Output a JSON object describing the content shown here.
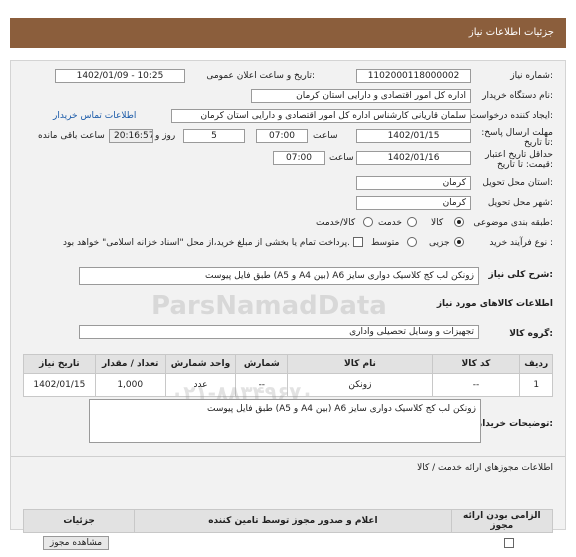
{
  "header": {
    "title": "جزئیات اطلاعات نیاز"
  },
  "fields": {
    "need_number_label": "شماره نیاز:",
    "need_number": "1102000118000002",
    "announce_label": "تاریخ و ساعت اعلان عمومی:",
    "announce_value": "1402/01/09 - 10:25",
    "buyer_org_label": "نام دستگاه خریدار:",
    "buyer_org": "اداره کل امور اقتصادی و دارایی استان کرمان",
    "creator_label": "ایجاد کننده درخواست:",
    "creator": "سلمان قاریانی کارشناس اداره کل امور اقتصادی و دارایی استان کرمان",
    "contact_link": "اطلاعات تماس خریدار",
    "deadline_label": "مهلت ارسال پاسخ: تا تاریخ:",
    "deadline_date": "1402/01/15",
    "deadline_time_label": "ساعت",
    "deadline_time": "07:00",
    "days_value": "5",
    "days_label": "روز و",
    "remaining_time": "20:16:57",
    "remaining_label": "ساعت باقی مانده",
    "min_validity_label": "حداقل تاریخ اعتبار قیمت: تا تاریخ:",
    "min_validity_date": "1402/01/16",
    "min_validity_time_label": "ساعت",
    "min_validity_time": "07:00",
    "province_label": "استان محل تحویل:",
    "province": "کرمان",
    "city_label": "شهر محل تحویل:",
    "city": "کرمان",
    "category_label": "طبقه بندی موضوعی:",
    "category_options": [
      "کالا",
      "خدمت",
      "کالا/خدمت"
    ],
    "process_label": "نوع فرآیند خرید :",
    "process_options": [
      "جزیی",
      "متوسط"
    ],
    "payment_note": "پرداخت تمام یا بخشی از مبلغ خرید،از محل \"اسناد خزانه اسلامی\" خواهد بود."
  },
  "description": {
    "label": "شرح کلی نیاز:",
    "text": "زونکن لب کج کلاسیک دواری سایز A6 (بین A4 و A5) طبق فایل پیوست"
  },
  "goods": {
    "section_title": "اطلاعات کالاهای مورد نیاز",
    "group_label": "گروه کالا:",
    "group_value": "تجهیزات و وسایل تحصیلی واداری",
    "columns": [
      "ردیف",
      "کد کالا",
      "نام کالا",
      "شمارش",
      "واحد شمارش",
      "تعداد / مقدار",
      "تاریخ نیاز"
    ],
    "rows": [
      {
        "row": "1",
        "code": "--",
        "name": "زونکن",
        "count": "--",
        "unit": "عدد",
        "qty": "1,000",
        "date": "1402/01/15"
      }
    ]
  },
  "buyer_notes": {
    "label": "توضیحات خریدار:",
    "text": "زونکن لب کج کلاسیک دواری سایز A6 (بین A4 و A5) طبق فایل پیوست"
  },
  "service": {
    "section_title": "اطلاعات مجوزهای ارائه خدمت / کالا",
    "columns": [
      "الزامی بودن ارائه مجوز",
      "اعلام و صدور مجوز توسط تامین کننده",
      "جزئیات"
    ],
    "view_button": "مشاهده مجوز"
  },
  "watermark": {
    "brand": "ParsNamadData",
    "phone": "۰۲۱-۸۸۳۴۹۶۷۰"
  },
  "colors": {
    "header": "#8b5e3c",
    "link": "#1a5aa8"
  }
}
